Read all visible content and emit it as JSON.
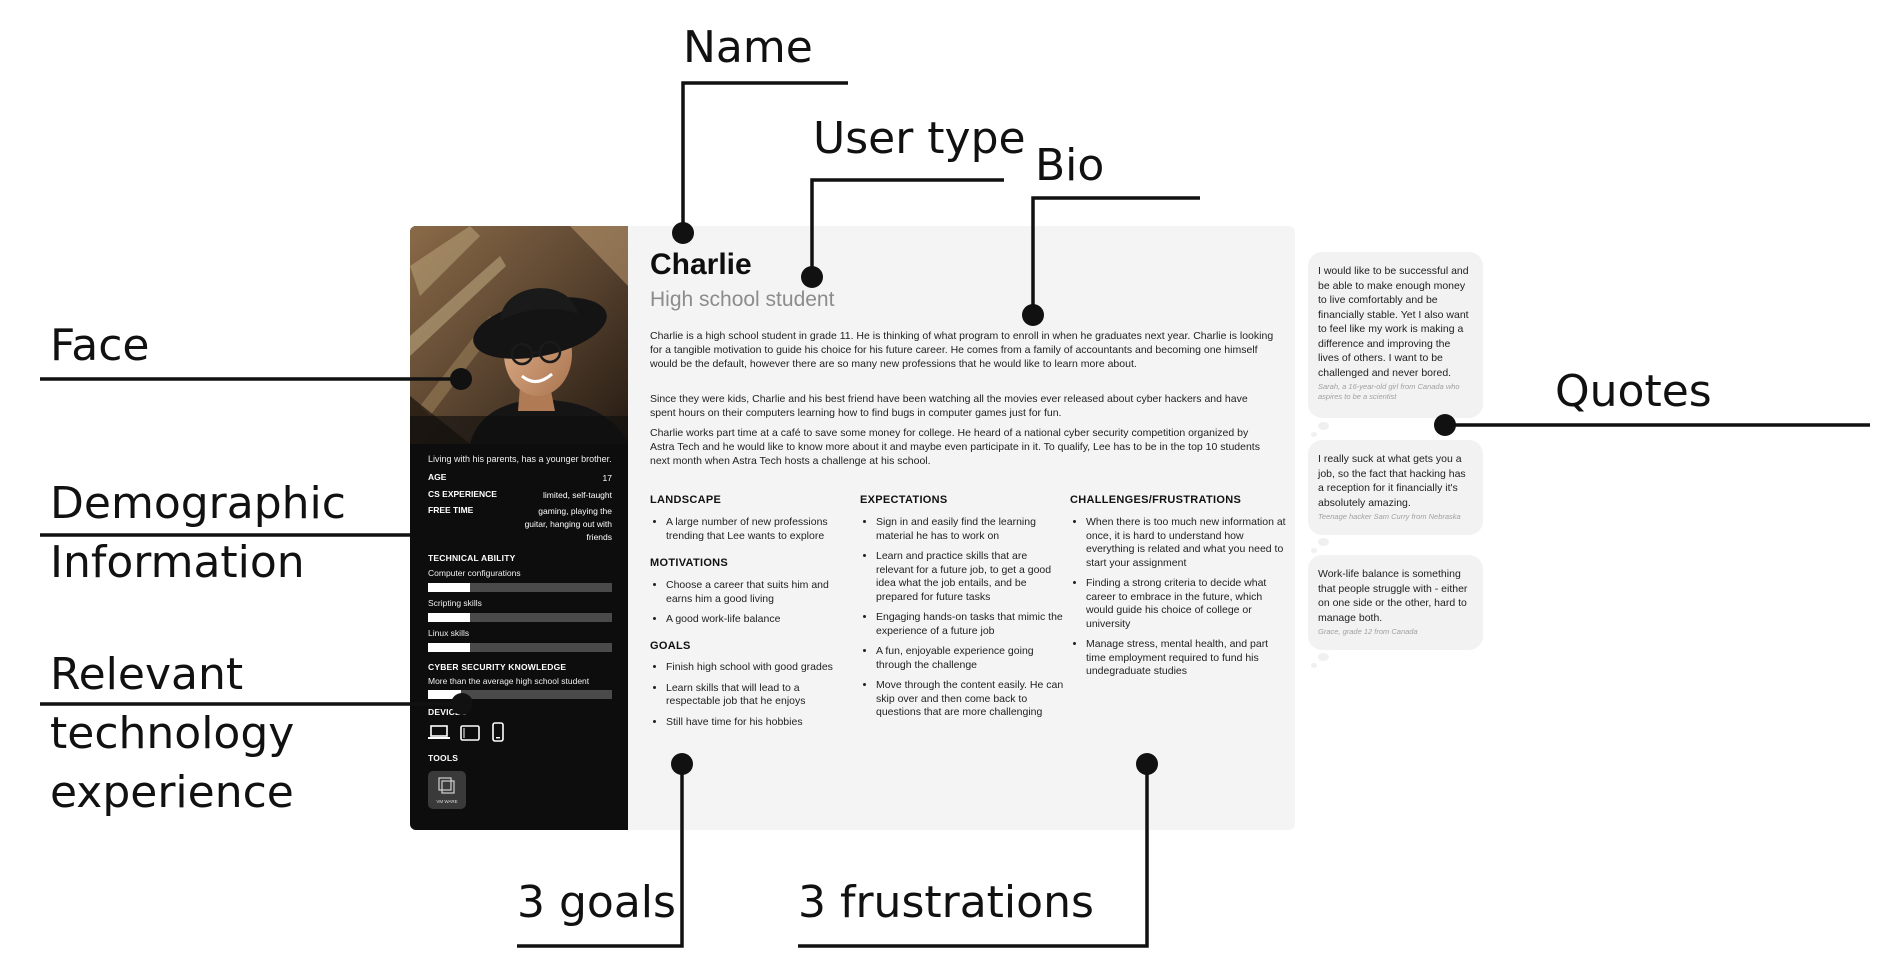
{
  "callouts": {
    "name": "Name",
    "user_type": "User type",
    "bio": "Bio",
    "face": "Face",
    "demographic": [
      "Demographic",
      "Information"
    ],
    "technology": [
      "Relevant",
      "technology",
      "experience"
    ],
    "quotes": "Quotes",
    "goals": "3 goals",
    "frustrations": "3 frustrations"
  },
  "persona": {
    "name": "Charlie",
    "user_type": "High school student",
    "bio": [
      "Charlie is a high school student in grade 11. He is thinking of what program to enroll in when he graduates next year. Charlie is looking for a tangible motivation to guide his choice for his future career. He comes from a family of accountants and becoming one himself would be the default, however there are so many new professions that he would like to learn more about.",
      "Since they were kids, Charlie and his best friend have been watching all the movies ever released about cyber hackers and have spent hours on their computers learning how to find bugs in computer games just for fun.",
      "Charlie works part time at a café to save some money for college. He heard of a national cyber security competition organized by Astra Tech and he would like to know more about it and maybe even participate in it. To qualify, Lee has to be in the top 10 students next month when Astra Tech hosts a challenge at his school."
    ],
    "living": "Living with his parents, has a younger brother.",
    "demographics": [
      {
        "label": "AGE",
        "value": "17"
      },
      {
        "label": "CS EXPERIENCE",
        "value": "limited, self-taught"
      },
      {
        "label": "FREE TIME",
        "value": "gaming, playing the guitar, hanging out with friends"
      }
    ],
    "technical_ability_heading": "TECHNICAL ABILITY",
    "skills": [
      {
        "label": "Computer configurations",
        "level": 0.23
      },
      {
        "label": "Scripting skills",
        "level": 0.23
      },
      {
        "label": "Linux skills",
        "level": 0.23
      }
    ],
    "cyber_heading": "CYBER SECURITY KNOWLEDGE",
    "cyber_text": "More than the average high school student",
    "cyber_level": 0.18,
    "devices_heading": "DEVICES",
    "devices": [
      "laptop-icon",
      "tablet-icon",
      "phone-icon"
    ],
    "tools_heading": "TOOLS",
    "tool_label": "VM WARE",
    "landscape_heading": "LANDSCAPE",
    "landscape": [
      "A large number of new professions trending that Lee wants to explore"
    ],
    "motivations_heading": "MOTIVATIONS",
    "motivations": [
      "Choose a career that suits him and earns him a good living",
      "A good work-life balance"
    ],
    "goals_heading": "GOALS",
    "goals": [
      "Finish high school with good grades",
      "Learn skills that will lead to a respectable job that he enjoys",
      "Still have time for his hobbies"
    ],
    "expectations_heading": "EXPECTATIONS",
    "expectations": [
      "Sign in and easily find the learning material he has to work on",
      "Learn and practice skills that are relevant for a future job, to get a good idea what the job entails, and be prepared for future tasks",
      "Engaging hands-on tasks that mimic the experience of a future job",
      "A fun, enjoyable experience going through the challenge",
      "Move through the content easily. He can skip over and then come back to questions that are more challenging"
    ],
    "challenges_heading": "CHALLENGES/FRUSTRATIONS",
    "challenges": [
      "When there is too much new information at once, it is hard to understand how everything is related and what you need to start your assignment",
      "Finding a strong criteria to decide what career to embrace in the future, which would guide his choice of college or university",
      "Manage stress, mental health, and part time employment required to fund his undegraduate studies"
    ]
  },
  "quotes": [
    {
      "text": "I would like to be successful and be able to make enough money to live comfortably and be financially stable. Yet I also want to feel like my work is making a difference and improving the lives of others. I want to be challenged and never bored.",
      "author": "Sarah, a 16-year-old girl from Canada who aspires to be a scientist"
    },
    {
      "text": "I really suck at what gets you a job, so the fact that hacking has a reception for it financially it's absolutely amazing.",
      "author": "Teenage hacker Sam Curry from Nebraska"
    },
    {
      "text": "Work-life balance is something that people struggle with - either on one side or the other, hard to manage both.",
      "author": "Grace, grade 12 from Canada"
    }
  ],
  "colors": {
    "sidebar": "#0d0d0d",
    "card": "#f4f4f4",
    "user_type": "#8c8c8c",
    "line": "#111111"
  }
}
